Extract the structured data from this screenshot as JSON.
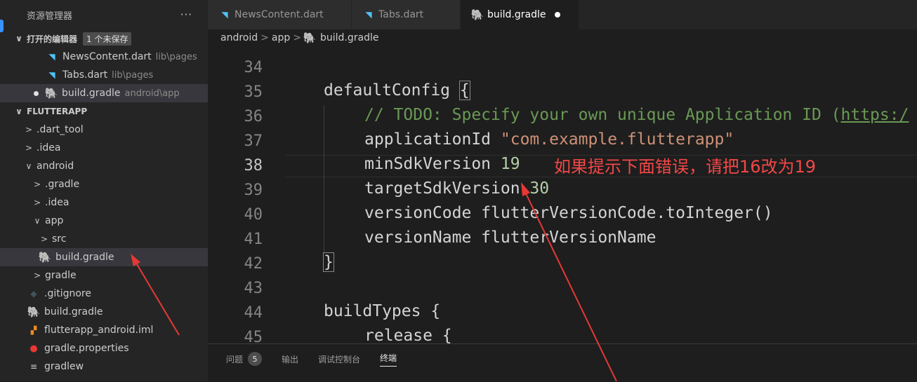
{
  "sidebar": {
    "title": "资源管理器",
    "more": "···",
    "open_editors": {
      "label": "打开的编辑器",
      "badge": "1 个未保存"
    },
    "open_files": [
      {
        "name": "NewsContent.dart",
        "path": "lib\\pages",
        "icon": "dart-icon"
      },
      {
        "name": "Tabs.dart",
        "path": "lib\\pages",
        "icon": "dart-icon"
      },
      {
        "name": "build.gradle",
        "path": "android\\app",
        "icon": "gradle-icon"
      }
    ],
    "project": "FLUTTERAPP",
    "tree": {
      "dart_tool": ".dart_tool",
      "idea": ".idea",
      "android": "android",
      "gradle_dir": ".gradle",
      "android_idea": ".idea",
      "app": "app",
      "src": "src",
      "app_build_gradle": "build.gradle",
      "gradle": "gradle",
      "gitignore": ".gitignore",
      "build_gradle": "build.gradle",
      "iml": "flutterapp_android.iml",
      "gradle_properties": "gradle.properties",
      "gradlew": "gradlew"
    }
  },
  "tabs": [
    {
      "label": "NewsContent.dart",
      "icon": "dart-icon"
    },
    {
      "label": "Tabs.dart",
      "icon": "dart-icon"
    },
    {
      "label": "build.gradle",
      "icon": "gradle-icon"
    }
  ],
  "breadcrumb": {
    "items": [
      "android",
      "app",
      "build.gradle"
    ],
    "sep": ">"
  },
  "editor": {
    "line_numbers": [
      "34",
      "35",
      "36",
      "37",
      "38",
      "39",
      "40",
      "41",
      "42",
      "43",
      "44",
      "45"
    ],
    "current_line": "38",
    "code": {
      "l35_kw": "defaultConfig ",
      "l35_brace": "{",
      "l36_comment": "// TODO: Specify your own unique Application ID (",
      "l36_link": "https:/",
      "l37_key": "applicationId ",
      "l37_str": "\"com.example.flutterapp\"",
      "l38_key": "minSdkVersion ",
      "l38_num": "19",
      "l39_key": "targetSdkVersion ",
      "l39_num": "30",
      "l40": "versionCode flutterVersionCode.toInteger()",
      "l41": "versionName flutterVersionName",
      "l42_brace": "}",
      "l44": "buildTypes {",
      "l45": "release {"
    },
    "annotation": "如果提示下面错误，请把16改为19"
  },
  "panel": {
    "tabs": [
      "问题",
      "输出",
      "调试控制台",
      "终端"
    ],
    "problems_count": "5"
  },
  "colors": {
    "background": "#1e1e1e",
    "sidebar": "#252526",
    "annotation": "#f44747",
    "arrow": "#e53935",
    "comment": "#6a9955",
    "string": "#ce9178",
    "number": "#b5cea8"
  }
}
